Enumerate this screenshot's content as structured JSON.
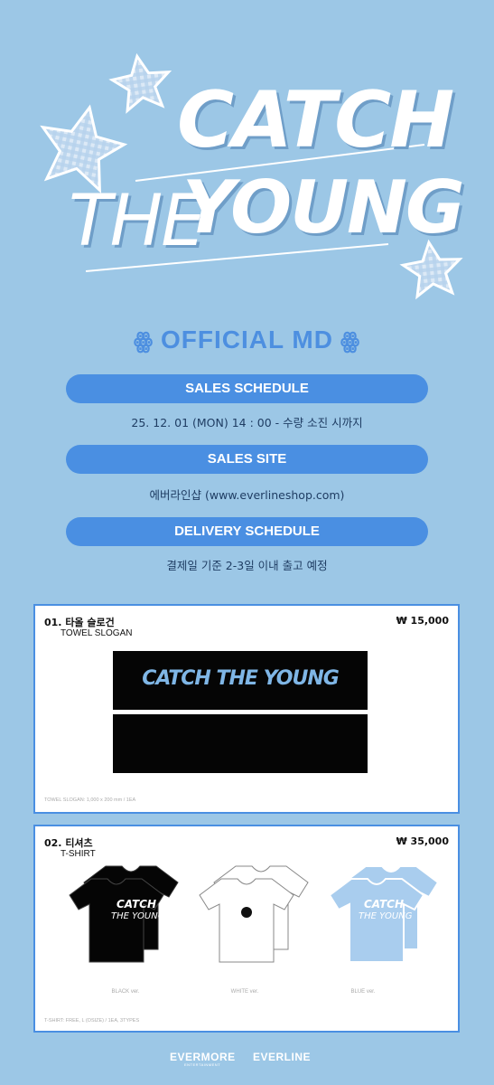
{
  "header": {
    "logo_line1": "CATCH",
    "logo_line2": "THE",
    "logo_line3": "YOUNG",
    "official_md": "OFFICIAL MD"
  },
  "schedule": {
    "sales_schedule_label": "SALES SCHEDULE",
    "sales_schedule_value": "25. 12. 01 (MON) 14 : 00  -  수량 소진 시까지",
    "sales_site_label": "SALES SITE",
    "sales_site_value": "에버라인샵 (www.everlineshop.com)",
    "delivery_label": "DELIVERY SCHEDULE",
    "delivery_value": "결제일 기준 2-3일 이내 출고 예정"
  },
  "products": [
    {
      "name": "01. 타올 슬로건",
      "sub": "TOWEL SLOGAN",
      "price": "₩ 15,000",
      "spec": "TOWEL SLOGAN: 1,000 x 200 mm / 1EA",
      "print": "CATCH THE YOUNG"
    },
    {
      "name": "02. 티셔츠",
      "sub": "T-SHIRT",
      "price": "₩ 35,000",
      "spec": "T-SHIRT: FREE, L (OSIZE) / 1EA, 3TYPES",
      "variants": [
        "BLACK ver.",
        "WHITE ver.",
        "BLUE ver."
      ]
    }
  ],
  "footer": {
    "brand1": "EVERMORE",
    "brand1_sub": "ENTERTAINMENT",
    "brand2": "EVERLINE"
  },
  "colors": {
    "background": "#9cc7e6",
    "accent": "#4a8fe2",
    "logo_shadow": "#6f9ec8"
  }
}
